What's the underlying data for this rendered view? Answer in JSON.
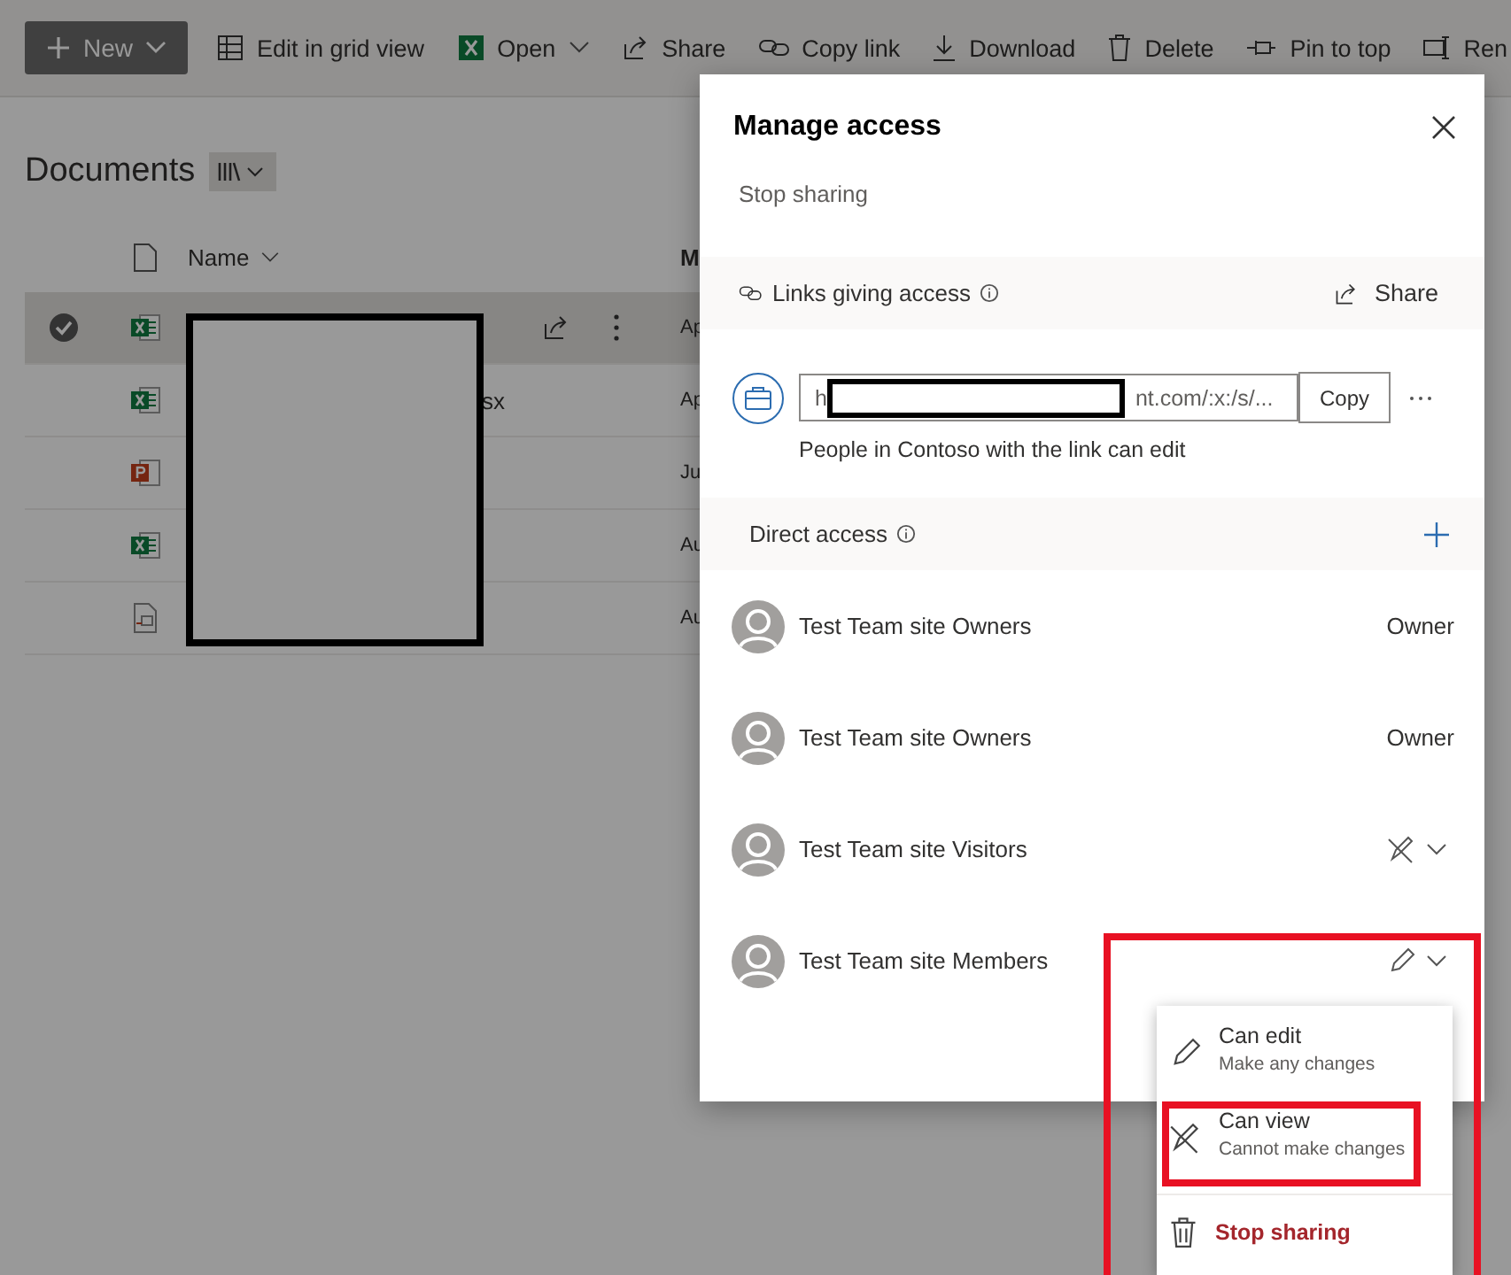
{
  "toolbar": {
    "new_button": "New",
    "items": [
      {
        "kind": "grid",
        "label": "Edit in grid view"
      },
      {
        "kind": "excel",
        "label": "Open",
        "dropdown": true
      },
      {
        "kind": "share",
        "label": "Share"
      },
      {
        "kind": "link",
        "label": "Copy link"
      },
      {
        "kind": "download",
        "label": "Download"
      },
      {
        "kind": "delete",
        "label": "Delete"
      },
      {
        "kind": "pin",
        "label": "Pin to top"
      },
      {
        "kind": "rename",
        "label": "Ren"
      }
    ]
  },
  "library": {
    "title": "Documents"
  },
  "files": {
    "columns": [
      "Name",
      "M"
    ],
    "rows": [
      {
        "kind": "excel",
        "selected": true,
        "modified": "Ap"
      },
      {
        "kind": "excel",
        "selected": false,
        "name": "sx",
        "modified": "Ap"
      },
      {
        "kind": "powerpoint",
        "selected": false,
        "modified": "Ju"
      },
      {
        "kind": "excel",
        "selected": false,
        "modified": "Au"
      },
      {
        "kind": "file",
        "selected": false,
        "modified": "Au"
      }
    ]
  },
  "dialog": {
    "title": "Manage access",
    "stop_sharing": "Stop sharing",
    "links_header": "Links giving access",
    "share": "Share",
    "link": {
      "url_start": "h",
      "url_end": "nt.com/:x:/s/...",
      "copy": "Copy",
      "description": "People in Contoso with the link can edit"
    },
    "direct_header": "Direct access",
    "people": [
      {
        "name": "Test Team site Owners",
        "kind": "role",
        "role": "Owner"
      },
      {
        "name": "Test Team site Owners",
        "kind": "role",
        "role": "Owner"
      },
      {
        "name": "Test Team site Visitors",
        "kind": "view"
      },
      {
        "name": "Test Team site Members",
        "kind": "edit"
      }
    ]
  },
  "menu": {
    "items": [
      {
        "kind": "edit",
        "title": "Can edit",
        "subtitle": "Make any changes"
      },
      {
        "kind": "view",
        "title": "Can view",
        "subtitle": "Cannot make changes"
      },
      {
        "kind": "delete",
        "title": "Stop sharing"
      }
    ]
  }
}
